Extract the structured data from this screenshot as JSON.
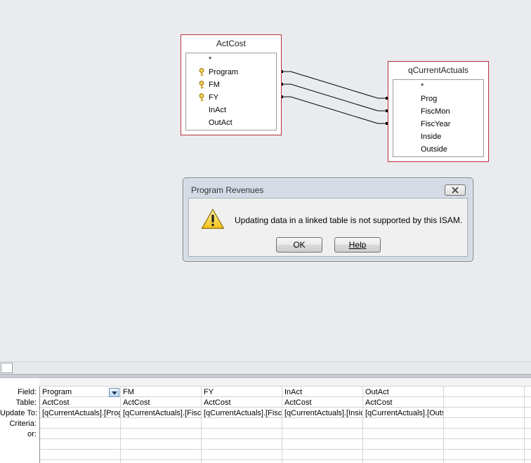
{
  "tables": {
    "actcost": {
      "title": "ActCost",
      "fields": [
        {
          "name": "*",
          "key": false
        },
        {
          "name": "Program",
          "key": true
        },
        {
          "name": "FM",
          "key": true
        },
        {
          "name": "FY",
          "key": true
        },
        {
          "name": "InAct",
          "key": false
        },
        {
          "name": "OutAct",
          "key": false
        }
      ]
    },
    "qcurrentactuals": {
      "title": "qCurrentActuals",
      "fields": [
        {
          "name": "*"
        },
        {
          "name": "Prog"
        },
        {
          "name": "FiscMon"
        },
        {
          "name": "FiscYear"
        },
        {
          "name": "Inside"
        },
        {
          "name": "Outside"
        }
      ]
    }
  },
  "dialog": {
    "title": "Program Revenues",
    "message": "Updating data in a linked table is not supported by this ISAM.",
    "ok_label": "OK",
    "help_label": "Help",
    "icon": "warning-icon"
  },
  "grid": {
    "row_labels": [
      "Field:",
      "Table:",
      "Update To:",
      "Criteria:",
      "or:"
    ],
    "columns": [
      {
        "field": "Program",
        "table": "ActCost",
        "update_to": "[qCurrentActuals].[Prog]"
      },
      {
        "field": "FM",
        "table": "ActCost",
        "update_to": "[qCurrentActuals].[FiscMon]"
      },
      {
        "field": "FY",
        "table": "ActCost",
        "update_to": "[qCurrentActuals].[FiscYear]"
      },
      {
        "field": "InAct",
        "table": "ActCost",
        "update_to": "[qCurrentActuals].[Inside]"
      },
      {
        "field": "OutAct",
        "table": "ActCost",
        "update_to": "[qCurrentActuals].[Outside]"
      }
    ]
  },
  "colors": {
    "table_border": "#b5323a",
    "surface": "#e9ebee",
    "dialog_frame": "#d4dbe5"
  }
}
